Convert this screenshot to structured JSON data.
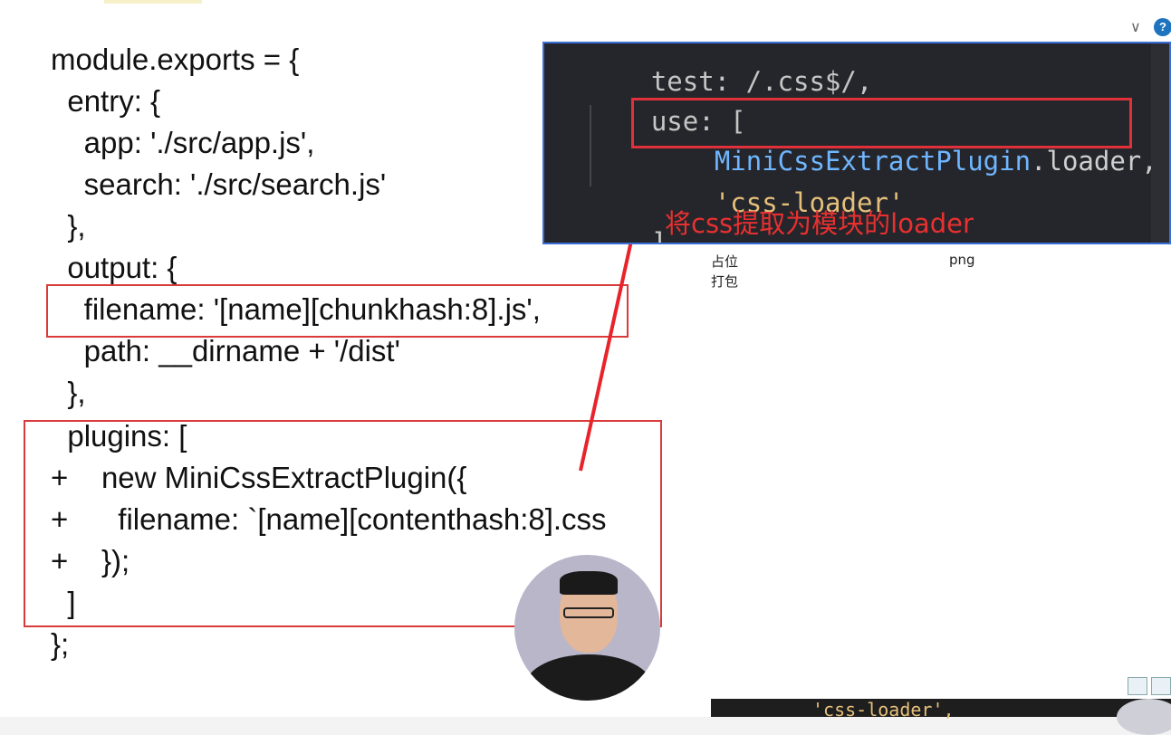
{
  "slide": {
    "code_lines": [
      "module.exports = {",
      "  entry: {",
      "    app: './src/app.js',",
      "    search: './src/search.js'",
      "  },",
      "  output: {",
      "    filename: '[name][chunkhash:8].js',",
      "    path: __dirname + '/dist'",
      "  },",
      "  plugins: [",
      "+    new MiniCssExtractPlugin({",
      "+      filename: `[name][contenthash:8].css",
      "+    });",
      "  ]",
      "};"
    ]
  },
  "popup": {
    "line_test": "test: /.css$/,",
    "line_use": "use: [",
    "loader_class": "MiniCssExtractPlugin",
    "loader_member": ".loader,",
    "css_loader": "'css-loader'",
    "close_bracket": "]",
    "annotation": "将css提取为模块的loader"
  },
  "background": {
    "fragment_1": "占位",
    "fragment_2": "打包",
    "fragment_png": "png",
    "bottom_code": "'css-loader',",
    "help_label": "?",
    "chevron": "∨"
  },
  "colors": {
    "highlight_box": "#d93a3a",
    "arrow": "#e8232a",
    "popup_bg": "#25262b",
    "popup_border": "#3a6fd8",
    "class_name": "#6fb6ff",
    "string": "#e6c07b"
  }
}
